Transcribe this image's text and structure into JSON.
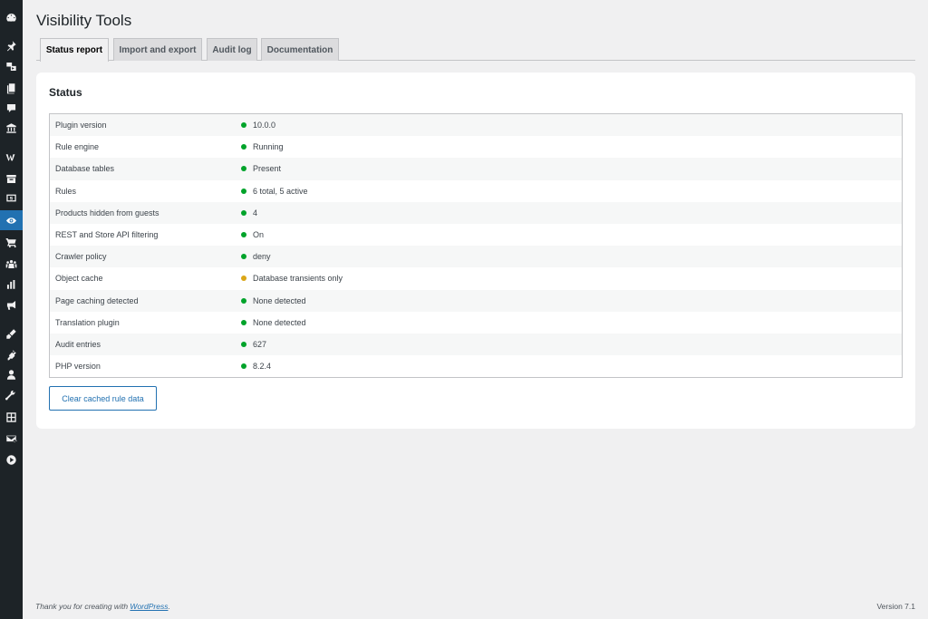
{
  "page": {
    "title": "Visibility Tools"
  },
  "tabs": [
    {
      "label": "Status report",
      "active": true
    },
    {
      "label": "Import and export",
      "active": false
    },
    {
      "label": "Audit log",
      "active": false
    },
    {
      "label": "Documentation",
      "active": false
    }
  ],
  "status": {
    "title": "Status",
    "rows": [
      {
        "label": "Plugin version",
        "value": "10.0.0",
        "status_color": "#00a32a"
      },
      {
        "label": "Rule engine",
        "value": "Running",
        "status_color": "#00a32a"
      },
      {
        "label": "Database tables",
        "value": "Present",
        "status_color": "#00a32a"
      },
      {
        "label": "Rules",
        "value": "6 total, 5 active",
        "status_color": "#00a32a"
      },
      {
        "label": "Products hidden from guests",
        "value": "4",
        "status_color": "#00a32a"
      },
      {
        "label": "REST and Store API filtering",
        "value": "On",
        "status_color": "#00a32a"
      },
      {
        "label": "Crawler policy",
        "value": "deny",
        "status_color": "#00a32a"
      },
      {
        "label": "Object cache",
        "value": "Database transients only",
        "status_color": "#dba617"
      },
      {
        "label": "Page caching detected",
        "value": "None detected",
        "status_color": "#00a32a"
      },
      {
        "label": "Translation plugin",
        "value": "None detected",
        "status_color": "#00a32a"
      },
      {
        "label": "Audit entries",
        "value": "627",
        "status_color": "#00a32a"
      },
      {
        "label": "PHP version",
        "value": "8.2.4",
        "status_color": "#00a32a"
      }
    ],
    "button_label": "Clear cached rule data"
  },
  "sidebar": {
    "items": [
      {
        "icon": "dashboard-icon"
      },
      {
        "icon": "pin-icon"
      },
      {
        "icon": "media-icon"
      },
      {
        "icon": "pages-icon"
      },
      {
        "icon": "comments-icon"
      },
      {
        "icon": "bank-icon"
      },
      {
        "icon": "woocommerce-icon"
      },
      {
        "icon": "archive-icon"
      },
      {
        "icon": "money-icon"
      },
      {
        "icon": "visibility-icon",
        "active": true
      },
      {
        "icon": "cart-icon"
      },
      {
        "icon": "community-icon"
      },
      {
        "icon": "analytics-icon"
      },
      {
        "icon": "megaphone-icon"
      },
      {
        "icon": "appearance-icon"
      },
      {
        "icon": "plugins-icon"
      },
      {
        "icon": "users-icon"
      },
      {
        "icon": "tools-icon"
      },
      {
        "icon": "settings-icon"
      },
      {
        "icon": "mail-icon"
      },
      {
        "icon": "play-icon"
      }
    ],
    "accent_color": "#2271b1"
  },
  "footer": {
    "thanks_prefix": "Thank you for creating with ",
    "thanks_link": "WordPress",
    "thanks_suffix": ".",
    "version": "Version 7.1"
  }
}
